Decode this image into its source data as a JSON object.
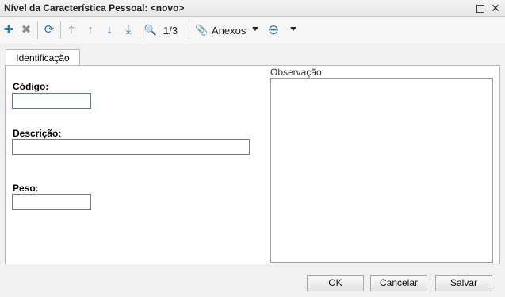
{
  "window": {
    "title": "Nível da Característica Pessoal: <novo>",
    "restore_icon": "restore-icon",
    "close_glyph": "✕"
  },
  "toolbar": {
    "add_glyph": "✚",
    "delete_glyph": "✖",
    "refresh_glyph": "⟳",
    "first_glyph": "⤒",
    "prev_glyph": "↑",
    "next_glyph": "↓",
    "last_glyph": "⤓",
    "search_glyph": "🔍",
    "counter": "1/3",
    "attach_glyph": "📎",
    "attachments_label": "Anexos",
    "view_glyph": "⊖"
  },
  "tabs": [
    {
      "label": "Identificação",
      "active": true
    }
  ],
  "form": {
    "codigo_label": "Código:",
    "codigo_value": "",
    "descricao_label": "Descrição:",
    "descricao_value": "",
    "peso_label": "Peso:",
    "peso_value": "",
    "observacao_label": "Observação:",
    "observacao_value": ""
  },
  "buttons": {
    "ok": "OK",
    "cancel": "Cancelar",
    "save": "Salvar"
  },
  "colors": {
    "accent": "#2a78b8",
    "disabled_icon": "#8a8f94",
    "focus_border": "#3c7fb1"
  }
}
